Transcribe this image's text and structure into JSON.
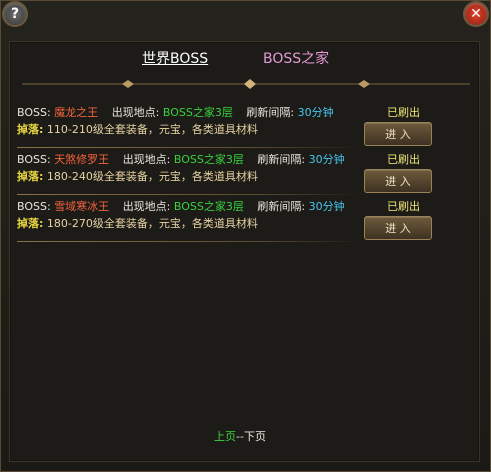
{
  "window": {
    "help_icon": "help-icon",
    "close_icon": "close-icon",
    "help_label": "?",
    "close_label": "✕"
  },
  "tabs": [
    {
      "label": "世界BOSS",
      "active": true
    },
    {
      "label": "BOSS之家",
      "active": false
    }
  ],
  "labels": {
    "boss_prefix": "BOSS:",
    "location_prefix": "出现地点:",
    "interval_prefix": "刷新间隔:",
    "drop_prefix": "掉落:"
  },
  "bosses": [
    {
      "name": "魔龙之王",
      "location": "BOSS之家3层",
      "interval": "30分钟",
      "status": "已刷出",
      "drops": "110-210级全套装备，元宝，各类道具材料",
      "button": "进 入"
    },
    {
      "name": "天煞修罗王",
      "location": "BOSS之家3层",
      "interval": "30分钟",
      "status": "已刷出",
      "drops": "180-240级全套装备，元宝，各类道具材料",
      "button": "进 入"
    },
    {
      "name": "雪域寒冰王",
      "location": "BOSS之家3层",
      "interval": "30分钟",
      "status": "已刷出",
      "drops": "180-270级全套装备，元宝，各类道具材料",
      "button": "进 入"
    }
  ],
  "pager": {
    "prev": "上页",
    "sep": "--",
    "next": "下页"
  },
  "colors": {
    "boss_name": "#f2623c",
    "location": "#39d23e",
    "interval": "#47c7ef",
    "status": "#f1e67a",
    "drop_label": "#e8d540"
  }
}
